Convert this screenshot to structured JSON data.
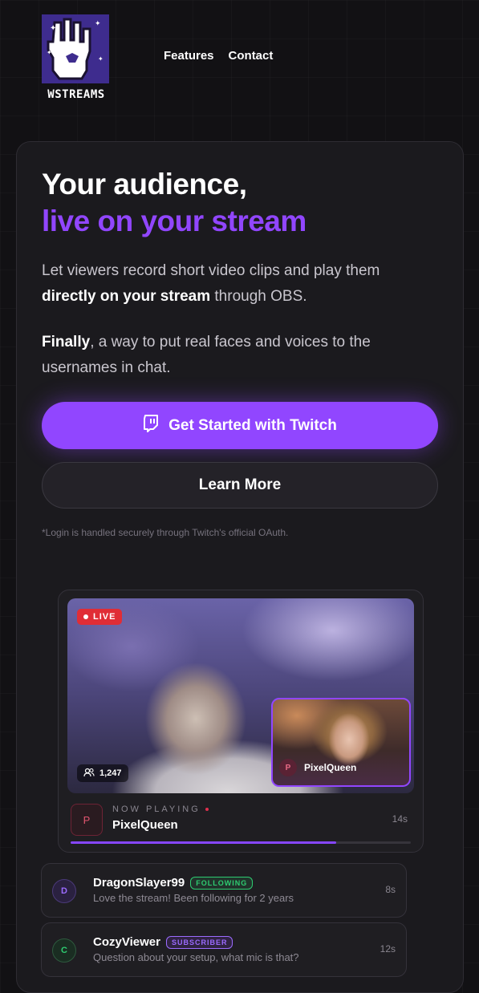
{
  "brand": {
    "name": "WSTREAMS",
    "logo_icon": "pixel-hand-w-icon"
  },
  "nav": {
    "items": [
      {
        "label": "Features"
      },
      {
        "label": "Contact"
      }
    ]
  },
  "hero": {
    "headline": "Your audience,",
    "headline_accent": "live on your stream",
    "p1_start": "Let viewers record short video clips and play them ",
    "p1_bold": "directly on your stream",
    "p1_end": " through OBS.",
    "p2_bold": "Finally",
    "p2_rest": ", a way to put real faces and voices to the usernames in chat.",
    "primary_button": "Get Started with Twitch",
    "secondary_button": "Learn More",
    "note": "*Login is handled securely through Twitch's official OAuth."
  },
  "player": {
    "live_label": "LIVE",
    "viewer_count": "1,247",
    "pip_initial": "P",
    "pip_name": "PixelQueen",
    "now_playing_label": "NOW PLAYING",
    "now_playing_initial": "P",
    "now_playing_name": "PixelQueen",
    "now_playing_time": "14s",
    "progress_fraction": 0.78
  },
  "messages": [
    {
      "initial": "D",
      "username": "DragonSlayer99",
      "badge": "FOLLOWING",
      "text": "Love the stream! Been following for 2 years",
      "time": "8s"
    },
    {
      "initial": "C",
      "username": "CozyViewer",
      "badge": "SUBSCRIBER",
      "text": "Question about your setup, what mic is that?",
      "time": "12s"
    }
  ],
  "colors": {
    "accent": "#9146ff",
    "live_red": "#e02d36",
    "following_green": "#2ecc71",
    "subscriber_purple": "#9b6bff"
  }
}
